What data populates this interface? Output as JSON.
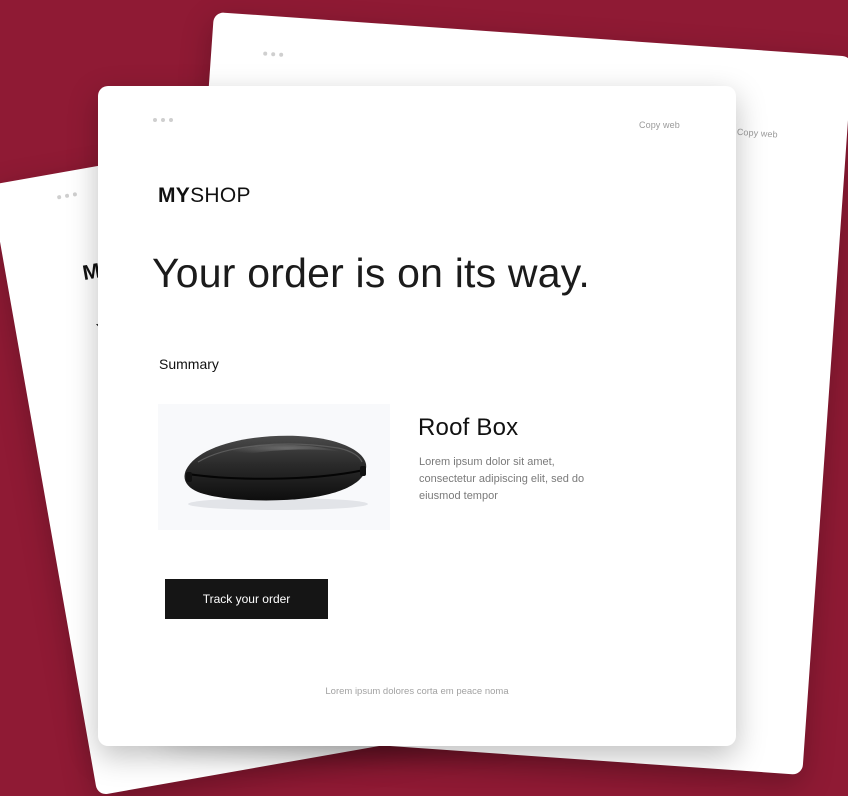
{
  "front_card": {
    "copy_web": "Copy web",
    "brand_bold": "MY",
    "brand_light": "SHOP",
    "headline": "Your order is on its way.",
    "summary_label": "Summary",
    "product": {
      "title": "Roof Box",
      "description": "Lorem ipsum dolor sit amet, consectetur adipiscing elit, sed do eiusmod tempor",
      "image_icon": "roof-box-image"
    },
    "cta_label": "Track your order",
    "footer": "Lorem ipsum dolores corta em peace noma"
  },
  "back_right_card": {
    "copy_web": "Copy web"
  },
  "back_left_card": {
    "brand_partial": "M",
    "headline_partial": "Y"
  },
  "colors": {
    "background": "#8f1a34",
    "card": "#ffffff",
    "button": "#151515",
    "button_text": "#ffffff"
  }
}
